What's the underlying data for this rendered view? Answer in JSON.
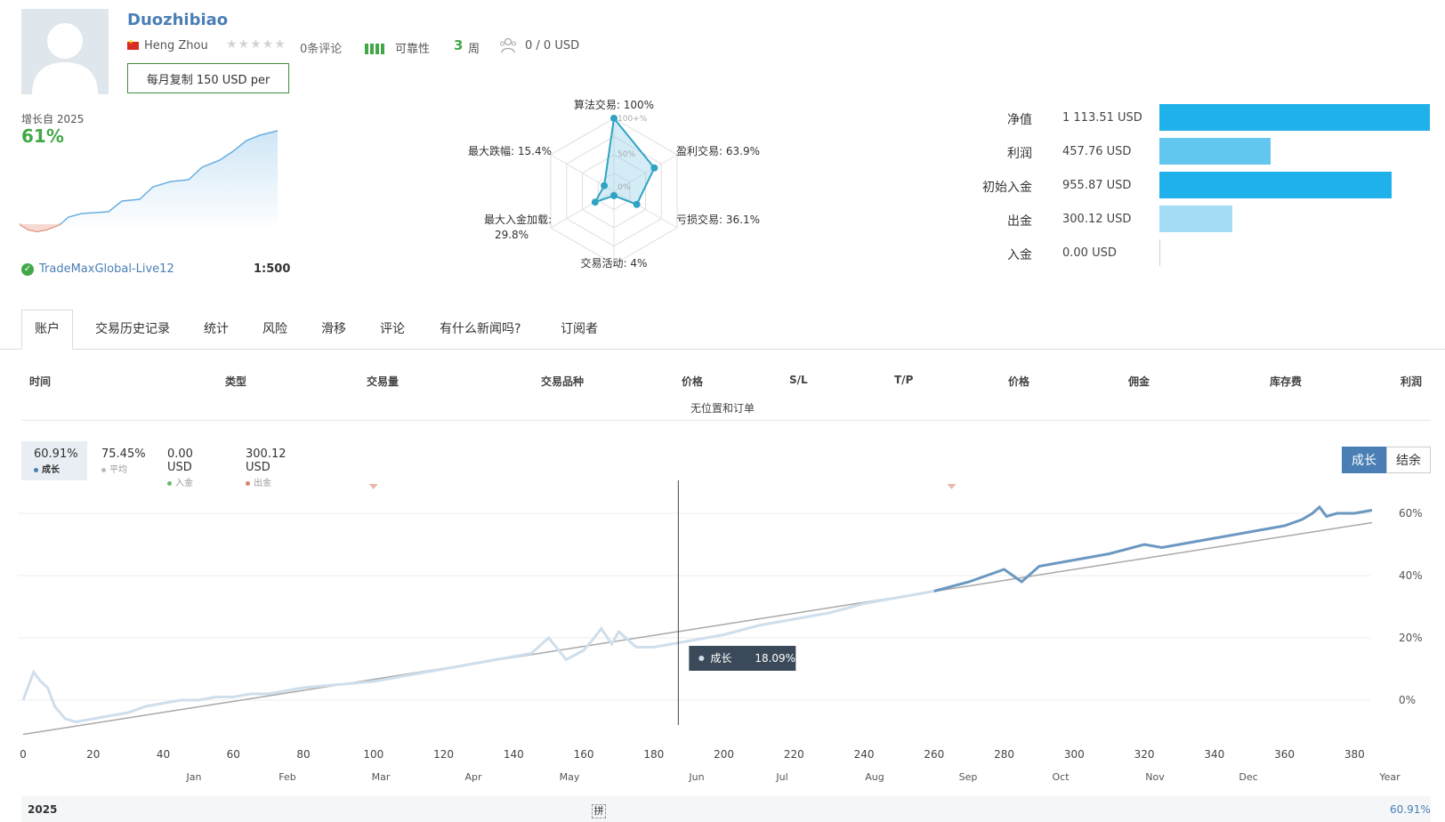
{
  "header": {
    "title": "Duozhibiao",
    "owner": "Heng Zhou",
    "reviews": "0条评论",
    "reliability_label": "可靠性",
    "weeks_num": "3",
    "weeks_unit": "周",
    "subscribers": "0 / 0 USD",
    "copy_button": "每月复制 150 USD per"
  },
  "summary": {
    "growth_since": "增长自 2025",
    "growth_pct": "61%",
    "server": "TradeMaxGlobal-Live12",
    "leverage": "1:500"
  },
  "radar": {
    "labels": {
      "algo": "算法交易: 100%",
      "profit": "盈利交易: 63.9%",
      "loss": "亏损交易: 36.1%",
      "activity": "交易活动: 4%",
      "deposit_load_1": "最大入金加载:",
      "deposit_load_2": "29.8%",
      "drawdown": "最大跌幅: 15.4%"
    },
    "ticks": [
      "100+%",
      "50%",
      "0%"
    ],
    "values": {
      "algo": 100,
      "profit": 63.9,
      "loss": 36.1,
      "activity": 4,
      "deposit_load": 29.8,
      "drawdown": 15.4
    }
  },
  "balance_bars": [
    {
      "label": "净值",
      "value": "1 113.51 USD",
      "amount": 1113.51,
      "color": "#1fb1ea"
    },
    {
      "label": "利润",
      "value": "457.76 USD",
      "amount": 457.76,
      "color": "#62c6ef"
    },
    {
      "label": "初始入金",
      "value": "955.87 USD",
      "amount": 955.87,
      "color": "#1fb1ea"
    },
    {
      "label": "出金",
      "value": "300.12 USD",
      "amount": 300.12,
      "color": "#a4ddf5"
    },
    {
      "label": "入金",
      "value": "0.00 USD",
      "amount": 0,
      "color": "#a4ddf5"
    }
  ],
  "tabs": [
    "账户",
    "交易历史记录",
    "统计",
    "风险",
    "滑移",
    "评论",
    "有什么新闻吗?",
    "订阅者"
  ],
  "table": {
    "headers": [
      "时间",
      "类型",
      "交易量",
      "交易品种",
      "价格",
      "S/L",
      "T/P",
      "价格",
      "佣金",
      "库存费",
      "利润"
    ],
    "empty_text": "无位置和订单"
  },
  "stats": [
    {
      "value": "60.91%",
      "label": "成长",
      "color": "#4a7fb5"
    },
    {
      "value": "75.45%",
      "label": "平均",
      "color": "#bbbbbb"
    },
    {
      "value": "0.00 USD",
      "label": "入金",
      "color": "#6db86d"
    },
    {
      "value": "300.12 USD",
      "label": "出金",
      "color": "#d9826a"
    }
  ],
  "chart_toggle": {
    "growth": "成长",
    "balance": "结余"
  },
  "chart_data": {
    "type": "line",
    "x_ticks": [
      0,
      20,
      40,
      60,
      80,
      100,
      120,
      140,
      160,
      180,
      200,
      220,
      240,
      260,
      280,
      300,
      320,
      340,
      360,
      380
    ],
    "y_ticks": [
      "60%",
      "40%",
      "20%",
      "0%"
    ],
    "ylim": [
      -10,
      70
    ],
    "xlim": [
      0,
      385
    ],
    "months": [
      "Jan",
      "Feb",
      "Mar",
      "Apr",
      "May",
      "Jun",
      "Jul",
      "Aug",
      "Sep",
      "Oct",
      "Nov",
      "Dec",
      "Year"
    ],
    "series": [
      {
        "x": [
          0,
          3,
          5,
          7,
          9,
          12,
          15,
          20,
          25,
          30,
          35,
          40,
          45,
          50,
          55,
          60,
          65,
          70,
          80,
          90,
          100,
          110,
          120,
          130,
          140,
          145,
          150,
          155,
          160,
          163,
          165,
          168,
          170,
          175,
          180,
          185,
          190,
          195,
          200,
          210,
          220,
          230,
          240,
          250,
          260,
          270,
          280,
          285,
          290,
          300,
          310,
          320,
          325,
          330,
          340,
          350,
          360,
          365,
          368,
          370,
          372,
          375,
          380,
          385
        ],
        "y": [
          0,
          9,
          6,
          4,
          -2,
          -6,
          -7,
          -6,
          -5,
          -4,
          -2,
          -1,
          0,
          0,
          1,
          1,
          2,
          2,
          4,
          5,
          6,
          8,
          10,
          12,
          14,
          15,
          20,
          13,
          16,
          20,
          23,
          18,
          22,
          17,
          17,
          18,
          19,
          20,
          21,
          24,
          26,
          28,
          31,
          33,
          35,
          38,
          42,
          38,
          43,
          45,
          47,
          50,
          49,
          50,
          52,
          54,
          56,
          58,
          60,
          62,
          59,
          60,
          60,
          61
        ]
      },
      {
        "x": [
          0,
          385
        ],
        "y": [
          -11,
          57
        ]
      }
    ],
    "tooltip": {
      "label": "成长",
      "value": "18.09%"
    },
    "bottom_year": "2025",
    "bottom_value": "60.91%",
    "bottom_mid": "拼"
  }
}
